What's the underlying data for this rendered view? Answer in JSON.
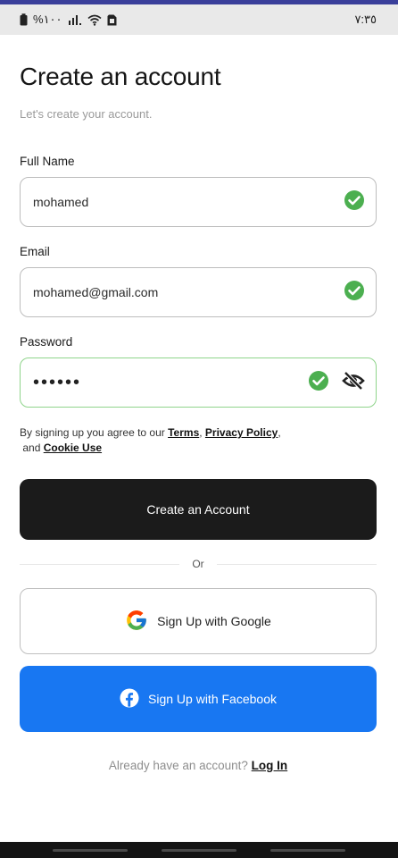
{
  "status": {
    "left_battery_percent": "%١٠٠",
    "time": "٧:٣٥"
  },
  "header": {
    "title": "Create an account",
    "subtitle": "Let's create your account."
  },
  "form": {
    "full_name": {
      "label": "Full Name",
      "value": "mohamed"
    },
    "email": {
      "label": "Email",
      "value": "mohamed@gmail.com"
    },
    "password": {
      "label": "Password",
      "value": "••••••"
    }
  },
  "terms": {
    "prefix": "By signing up you agree to our ",
    "terms_link": "Terms",
    "comma": ", ",
    "privacy_link": "Privacy Policy",
    "comma2": ",",
    "and": "and ",
    "cookie_link": "Cookie Use"
  },
  "buttons": {
    "create_account": "Create an Account",
    "divider": "Or",
    "google": "Sign Up with Google",
    "facebook": "Sign Up with Facebook"
  },
  "footer": {
    "prompt": "Already have an account? ",
    "login_link": "Log In"
  },
  "colors": {
    "accent_green": "#4caf50",
    "facebook_blue": "#1877f2",
    "primary_dark": "#1b1b1b"
  }
}
